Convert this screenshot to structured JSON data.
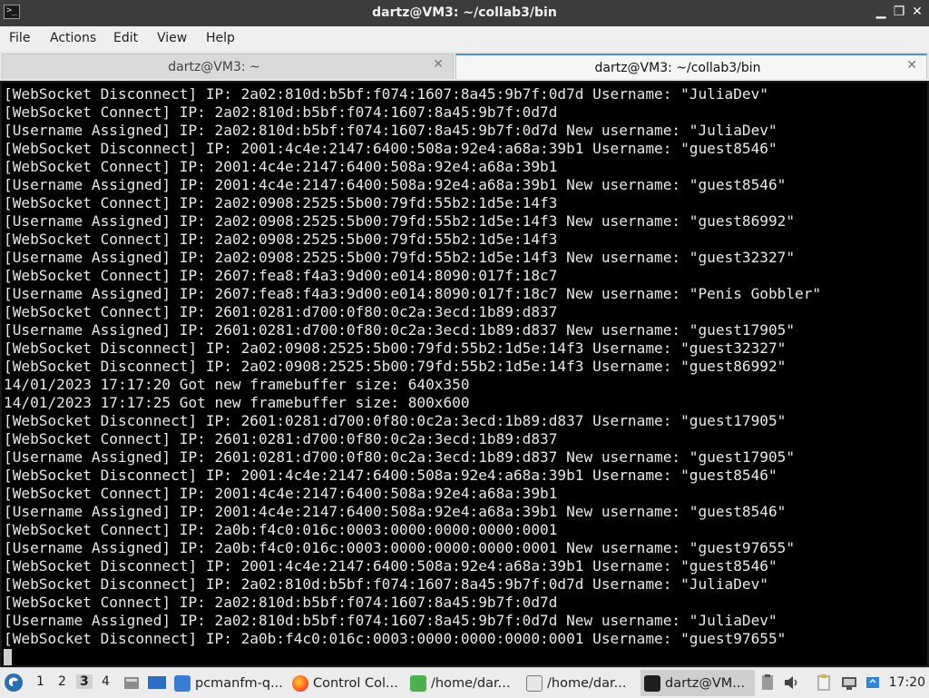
{
  "window": {
    "title": "dartz@VM3: ~/collab3/bin",
    "app_icon_glyph": ">_",
    "controls": {
      "minimize": "▁",
      "restore": "❐",
      "close": "✕"
    }
  },
  "menubar": {
    "items": [
      "File",
      "Actions",
      "Edit",
      "View",
      "Help"
    ]
  },
  "tabs": [
    {
      "label": "dartz@VM3: ~",
      "active": false
    },
    {
      "label": "dartz@VM3: ~/collab3/bin",
      "active": true
    }
  ],
  "tab_close_glyph": "✕",
  "terminal": {
    "lines": [
      "[WebSocket Disconnect] IP: 2a02:810d:b5bf:f074:1607:8a45:9b7f:0d7d Username: \"JuliaDev\"",
      "[WebSocket Connect] IP: 2a02:810d:b5bf:f074:1607:8a45:9b7f:0d7d",
      "[Username Assigned] IP: 2a02:810d:b5bf:f074:1607:8a45:9b7f:0d7d New username: \"JuliaDev\"",
      "[WebSocket Disconnect] IP: 2001:4c4e:2147:6400:508a:92e4:a68a:39b1 Username: \"guest8546\"",
      "[WebSocket Connect] IP: 2001:4c4e:2147:6400:508a:92e4:a68a:39b1",
      "[Username Assigned] IP: 2001:4c4e:2147:6400:508a:92e4:a68a:39b1 New username: \"guest8546\"",
      "[WebSocket Connect] IP: 2a02:0908:2525:5b00:79fd:55b2:1d5e:14f3",
      "[Username Assigned] IP: 2a02:0908:2525:5b00:79fd:55b2:1d5e:14f3 New username: \"guest86992\"",
      "[WebSocket Connect] IP: 2a02:0908:2525:5b00:79fd:55b2:1d5e:14f3",
      "[Username Assigned] IP: 2a02:0908:2525:5b00:79fd:55b2:1d5e:14f3 New username: \"guest32327\"",
      "[WebSocket Connect] IP: 2607:fea8:f4a3:9d00:e014:8090:017f:18c7",
      "[Username Assigned] IP: 2607:fea8:f4a3:9d00:e014:8090:017f:18c7 New username: \"Penis Gobbler\"",
      "[WebSocket Connect] IP: 2601:0281:d700:0f80:0c2a:3ecd:1b89:d837",
      "[Username Assigned] IP: 2601:0281:d700:0f80:0c2a:3ecd:1b89:d837 New username: \"guest17905\"",
      "[WebSocket Disconnect] IP: 2a02:0908:2525:5b00:79fd:55b2:1d5e:14f3 Username: \"guest32327\"",
      "[WebSocket Disconnect] IP: 2a02:0908:2525:5b00:79fd:55b2:1d5e:14f3 Username: \"guest86992\"",
      "14/01/2023 17:17:20 Got new framebuffer size: 640x350",
      "14/01/2023 17:17:25 Got new framebuffer size: 800x600",
      "[WebSocket Disconnect] IP: 2601:0281:d700:0f80:0c2a:3ecd:1b89:d837 Username: \"guest17905\"",
      "[WebSocket Connect] IP: 2601:0281:d700:0f80:0c2a:3ecd:1b89:d837",
      "[Username Assigned] IP: 2601:0281:d700:0f80:0c2a:3ecd:1b89:d837 New username: \"guest17905\"",
      "[WebSocket Disconnect] IP: 2001:4c4e:2147:6400:508a:92e4:a68a:39b1 Username: \"guest8546\"",
      "[WebSocket Connect] IP: 2001:4c4e:2147:6400:508a:92e4:a68a:39b1",
      "[Username Assigned] IP: 2001:4c4e:2147:6400:508a:92e4:a68a:39b1 New username: \"guest8546\"",
      "[WebSocket Connect] IP: 2a0b:f4c0:016c:0003:0000:0000:0000:0001",
      "[Username Assigned] IP: 2a0b:f4c0:016c:0003:0000:0000:0000:0001 New username: \"guest97655\"",
      "[WebSocket Disconnect] IP: 2001:4c4e:2147:6400:508a:92e4:a68a:39b1 Username: \"guest8546\"",
      "[WebSocket Disconnect] IP: 2a02:810d:b5bf:f074:1607:8a45:9b7f:0d7d Username: \"JuliaDev\"",
      "[WebSocket Connect] IP: 2a02:810d:b5bf:f074:1607:8a45:9b7f:0d7d",
      "[Username Assigned] IP: 2a02:810d:b5bf:f074:1607:8a45:9b7f:0d7d New username: \"JuliaDev\"",
      "[WebSocket Disconnect] IP: 2a0b:f4c0:016c:0003:0000:0000:0000:0001 Username: \"guest97655\""
    ]
  },
  "taskbar": {
    "workspaces": [
      "1",
      "2",
      "3",
      "4"
    ],
    "active_workspace": "3",
    "tasks": [
      {
        "label": "pcmanfm-q...",
        "icon": "folder-icon"
      },
      {
        "label": "Control Col...",
        "icon": "firefox-icon"
      },
      {
        "label": "/home/dar...",
        "icon": "text-editor-icon"
      },
      {
        "label": "/home/dar...",
        "icon": "pen-editor-icon"
      },
      {
        "label": "dartz@VM...",
        "icon": "terminal-icon"
      }
    ],
    "clock": "17:20"
  },
  "colors": {
    "terminal_bg": "#000000",
    "terminal_fg": "#e8e8e8",
    "accent": "#4a90d9"
  }
}
